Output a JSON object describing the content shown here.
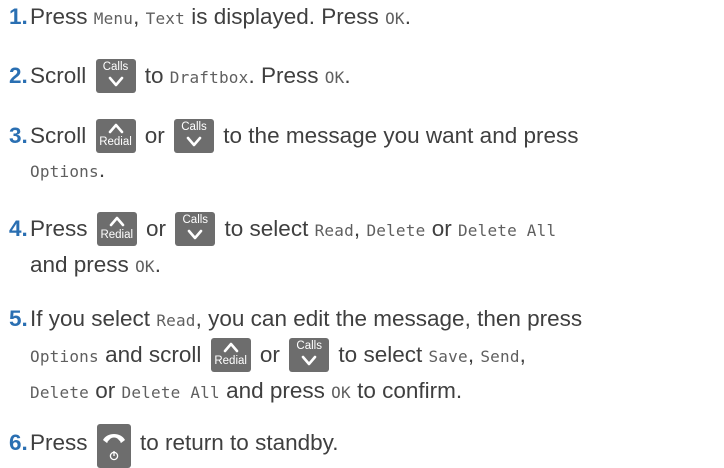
{
  "keys": {
    "calls": "Calls",
    "redial": "Redial"
  },
  "steps": [
    {
      "num": "1.",
      "t1": "Press ",
      "d1": "Menu",
      "t2": ", ",
      "d2": "Text",
      "t3": " is displayed. Press ",
      "d3": "OK",
      "t4": "."
    },
    {
      "num": "2.",
      "t1": "Scroll ",
      "t2": " to ",
      "d1": "Draftbox",
      "t3": ". Press ",
      "d2": "OK",
      "t4": "."
    },
    {
      "num": "3.",
      "t1": "Scroll ",
      "t2": " or ",
      "t3": " to the message you want and press",
      "d1": "Options",
      "t4": "."
    },
    {
      "num": "4.",
      "t1": "Press ",
      "t2": " or ",
      "t3": " to select ",
      "d1": "Read",
      "t4": ", ",
      "d2": "Delete",
      "t5": " or ",
      "d3": "Delete All",
      "t6": "and press ",
      "d4": "OK",
      "t7": "."
    },
    {
      "num": "5.",
      "t1": "If you select ",
      "d1": "Read",
      "t2": ", you can edit the message, then press",
      "d2": "Options",
      "t3": " and scroll ",
      "t4": " or ",
      "t5": " to select ",
      "d3": "Save",
      "t6": ", ",
      "d4": "Send",
      "t7": ",",
      "d5": "Delete",
      "t8": " or ",
      "d6": "Delete All",
      "t9": " and press ",
      "d7": "OK",
      "t10": " to confirm."
    },
    {
      "num": "6.",
      "t1": "Press ",
      "t2": " to return to standby."
    }
  ]
}
